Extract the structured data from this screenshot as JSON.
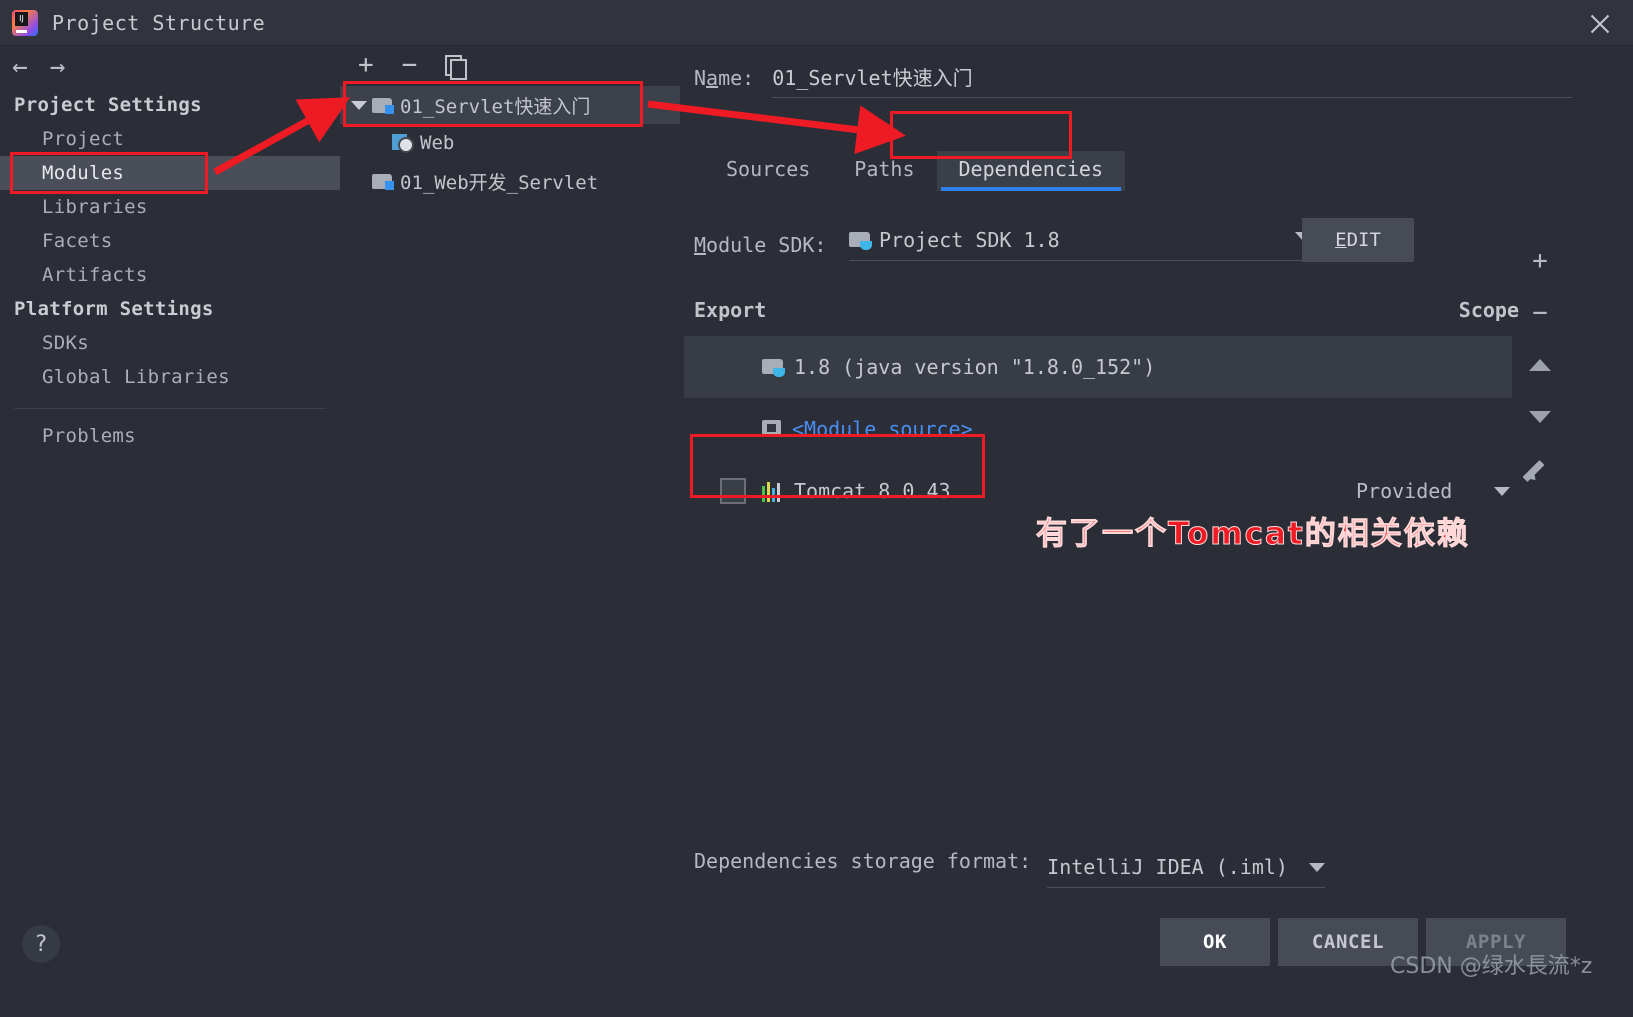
{
  "window": {
    "title": "Project Structure",
    "logo_icon": "intellij-idea-logo",
    "close_icon": "close-icon"
  },
  "nav": {
    "back_icon": "arrow-left-icon",
    "forward_icon": "arrow-right-icon"
  },
  "sidebar": {
    "groups": [
      {
        "label": "Project Settings",
        "items": [
          {
            "label": "Project",
            "selected": false
          },
          {
            "label": "Modules",
            "selected": true
          },
          {
            "label": "Libraries",
            "selected": false
          },
          {
            "label": "Facets",
            "selected": false
          },
          {
            "label": "Artifacts",
            "selected": false
          }
        ]
      },
      {
        "label": "Platform Settings",
        "items": [
          {
            "label": "SDKs",
            "selected": false
          },
          {
            "label": "Global Libraries",
            "selected": false
          }
        ]
      }
    ],
    "problems_label": "Problems"
  },
  "tree_toolbar": {
    "add_icon": "plus-icon",
    "remove_icon": "minus-icon",
    "copy_icon": "copy-icon"
  },
  "module_tree": {
    "nodes": [
      {
        "label": "01_Servlet快速入门",
        "icon": "module-icon",
        "selected": true,
        "expanded": true,
        "depth": 0
      },
      {
        "label": "Web",
        "icon": "web-facet-icon",
        "selected": false,
        "depth": 1
      },
      {
        "label": "01_Web开发_Servlet",
        "icon": "module-icon",
        "selected": false,
        "expanded": false,
        "depth": 0
      }
    ]
  },
  "module_panel": {
    "name_label": "Name:",
    "name_value": "01_Servlet快速入门",
    "tabs": [
      {
        "label": "Sources",
        "active": false
      },
      {
        "label": "Paths",
        "active": false
      },
      {
        "label": "Dependencies",
        "active": true
      }
    ],
    "sdk_label": "Module SDK:",
    "sdk_value": "Project SDK 1.8",
    "sdk_icon": "jdk-icon",
    "edit_button": "EDIT",
    "table": {
      "columns": [
        "Export",
        "Scope"
      ],
      "rows": [
        {
          "name": "1.8 (java version \"1.8.0_152\")",
          "icon": "jdk-icon",
          "export_checkbox": false,
          "checkbox_visible": false,
          "scope": "",
          "highlighted": true,
          "link": false
        },
        {
          "name": "<Module source>",
          "icon": "module-source-icon",
          "export_checkbox": false,
          "checkbox_visible": false,
          "scope": "",
          "highlighted": false,
          "link": true
        },
        {
          "name": "Tomcat 8.0.43",
          "icon": "tomcat-icon",
          "export_checkbox": false,
          "checkbox_visible": true,
          "scope": "Provided",
          "highlighted": false,
          "link": false
        }
      ]
    },
    "side_toolbar": [
      {
        "icon": "plus-icon",
        "glyph": "+"
      },
      {
        "icon": "minus-icon",
        "glyph": "−"
      },
      {
        "icon": "move-up-icon",
        "glyph": ""
      },
      {
        "icon": "move-down-icon",
        "glyph": ""
      },
      {
        "icon": "edit-pencil-icon",
        "glyph": ""
      }
    ],
    "storage_label": "Dependencies storage format:",
    "storage_value": "IntelliJ IDEA (.iml)"
  },
  "footer": {
    "help_icon": "help-icon",
    "help_glyph": "?",
    "buttons": [
      {
        "label": "OK",
        "state": "default"
      },
      {
        "label": "CANCEL",
        "state": "default"
      },
      {
        "label": "APPLY",
        "state": "disabled"
      }
    ]
  },
  "annotations": {
    "note_text": "有了一个Tomcat的相关依赖",
    "color": "#ee1b24"
  },
  "watermark": {
    "text": "CSDN @绿水長流*z"
  }
}
